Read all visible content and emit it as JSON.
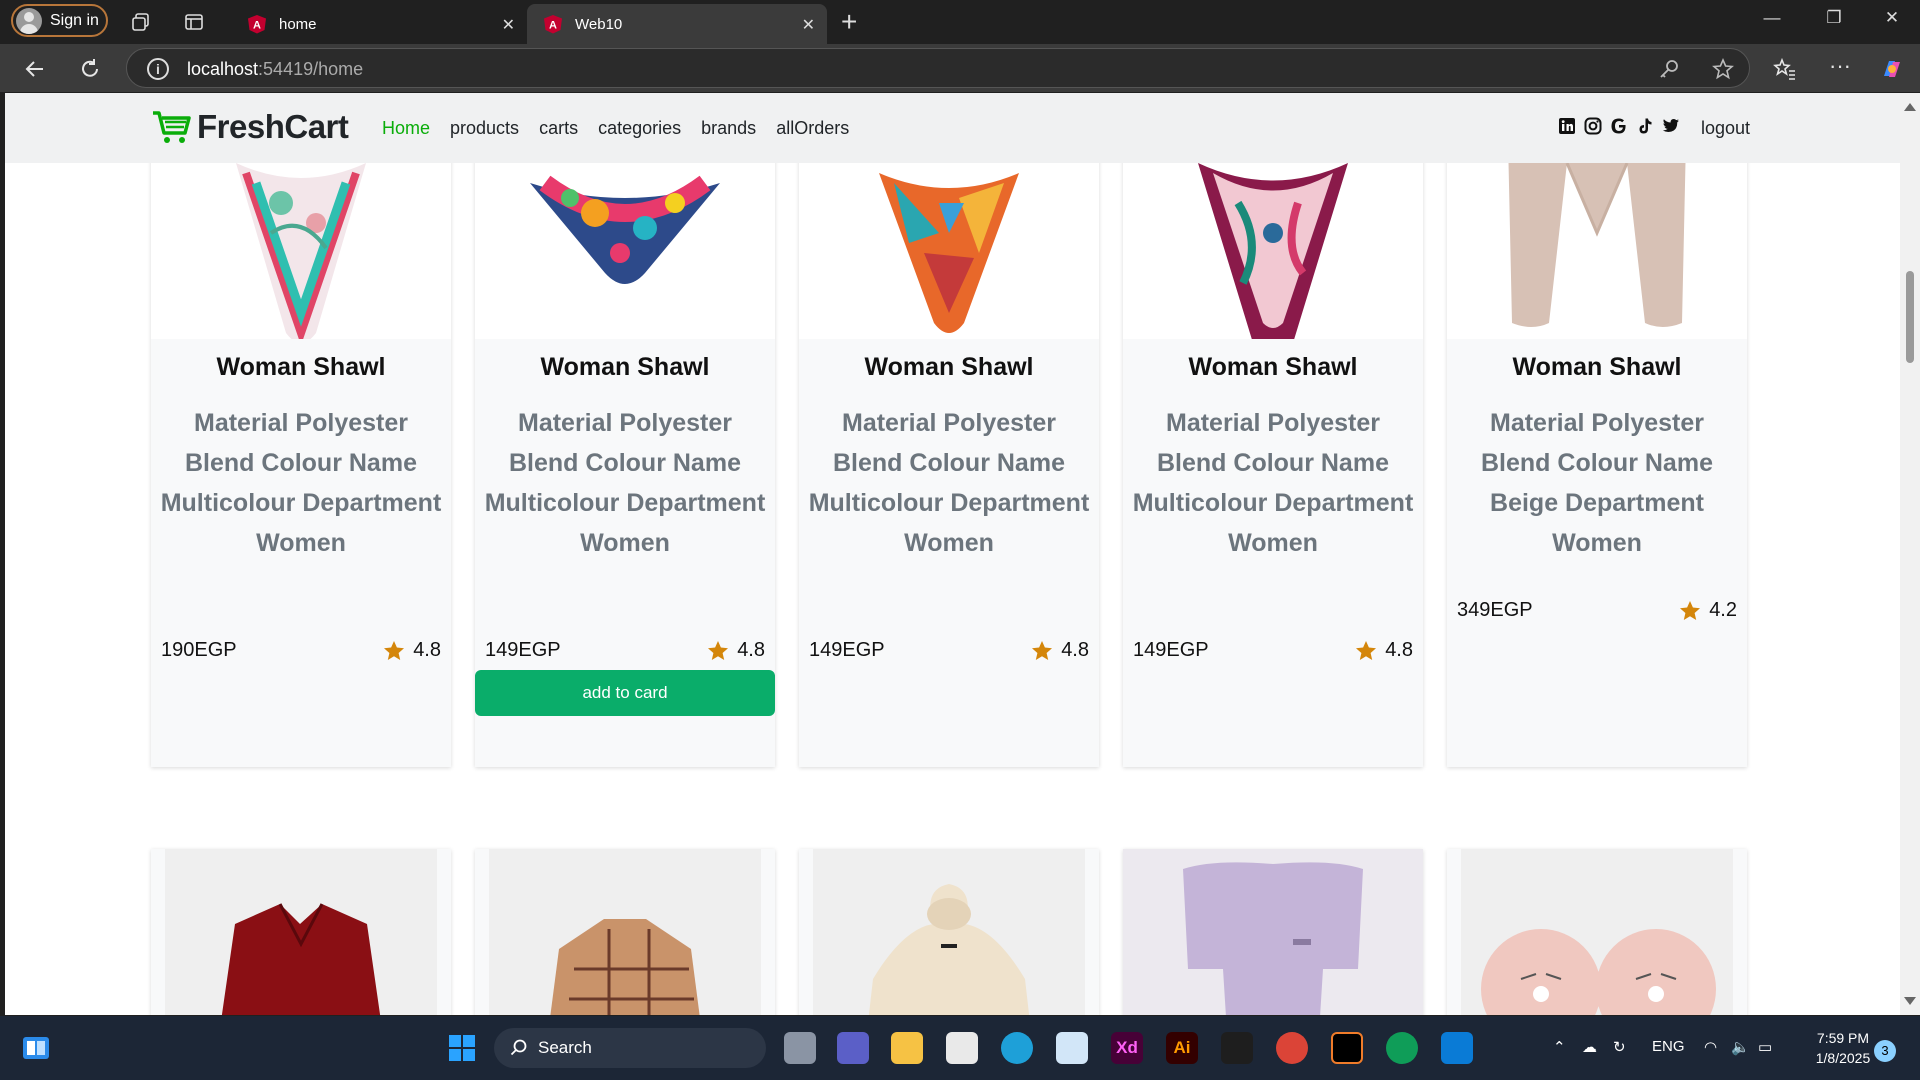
{
  "browser": {
    "signin_label": "Sign in",
    "tabs": [
      {
        "title": "home",
        "active": false
      },
      {
        "title": "Web10",
        "active": true
      }
    ],
    "url_host": "localhost",
    "url_rest": ":54419/home"
  },
  "site": {
    "brand": "FreshCart",
    "nav_links": [
      "Home",
      "products",
      "carts",
      "categories",
      "brands",
      "allOrders"
    ],
    "logout": "logout",
    "social_icons": [
      "linkedin-icon",
      "instagram-icon",
      "google-icon",
      "tiktok-icon",
      "twitter-icon"
    ]
  },
  "products": [
    {
      "title": "Woman Shawl",
      "description": "Material Polyester Blend Colour Name Multicolour Department Women",
      "price": "190EGP",
      "rating": "4.8"
    },
    {
      "title": "Woman Shawl",
      "description": "Material Polyester Blend Colour Name Multicolour Department Women",
      "price": "149EGP",
      "rating": "4.8",
      "button": "add to card"
    },
    {
      "title": "Woman Shawl",
      "description": "Material Polyester Blend Colour Name Multicolour Department Women",
      "price": "149EGP",
      "rating": "4.8"
    },
    {
      "title": "Woman Shawl",
      "description": "Material Polyester Blend Colour Name Multicolour Department Women",
      "price": "149EGP",
      "rating": "4.8"
    },
    {
      "title": "Woman Shawl",
      "description": "Material Polyester Blend Colour Name Beige Department Women",
      "price": "349EGP",
      "rating": "4.2"
    }
  ],
  "taskbar": {
    "search_label": "Search",
    "language": "ENG",
    "time": "7:59 PM",
    "date": "1/8/2025",
    "notifications": "3"
  },
  "colors": {
    "accent_green": "#0aad0a",
    "button_green": "#0aad6a",
    "star": "#d4860a"
  }
}
